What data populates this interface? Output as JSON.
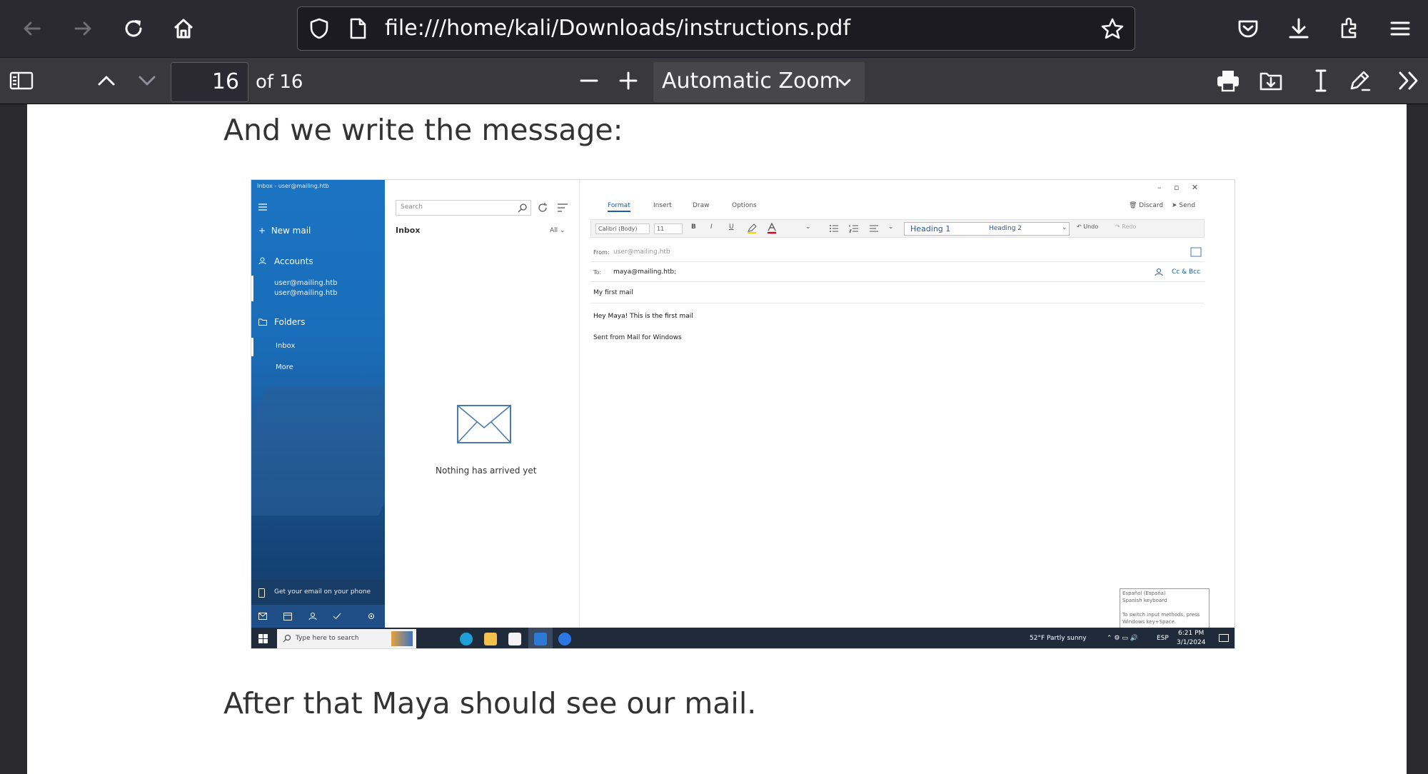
{
  "browser": {
    "url": "file:///home/kali/Downloads/instructions.pdf",
    "icons": [
      "back-arrow-icon",
      "forward-arrow-icon",
      "reload-icon",
      "home-icon",
      "shield-icon",
      "page-icon",
      "bookmark-star-icon",
      "pocket-icon",
      "download-icon",
      "extensions-icon",
      "hamburger-menu-icon"
    ]
  },
  "pdf_toolbar": {
    "page_number": "16",
    "page_count": "of 16",
    "zoom": "Automatic Zoom",
    "icons": [
      "sidebar-toggle-icon",
      "previous-page-icon",
      "next-page-icon",
      "zoom-out-icon",
      "zoom-in-icon",
      "print-icon",
      "save-icon",
      "text-select-icon",
      "draw-icon",
      "more-tools-icon"
    ]
  },
  "document": {
    "heading_text": "And we write the message:",
    "footer_text": "After that Maya should see our mail."
  },
  "screenshot": {
    "sidebar": {
      "window_title": "Inbox - user@mailing.htb",
      "new_mail": "New mail",
      "accounts": "Accounts",
      "account_1": "user@mailing.htb",
      "account_2": "user@mailing.htb",
      "folders": "Folders",
      "inbox": "Inbox",
      "more": "More",
      "phone_prompt": "Get your email on your phone"
    },
    "list": {
      "search_placeholder": "Search",
      "inbox_label": "Inbox",
      "filter": "All",
      "empty_message": "Nothing has arrived yet"
    },
    "compose": {
      "tabs": [
        "Format",
        "Insert",
        "Draw",
        "Options"
      ],
      "discard": "Discard",
      "send": "Send",
      "font": "Calibri (Body)",
      "font_size": "11",
      "style_1": "Heading 1",
      "style_2": "Heading 2",
      "undo": "Undo",
      "redo": "Redo",
      "from_label": "From:",
      "from_value": "user@mailing.htb",
      "to_label": "To:",
      "to_value": "maya@mailing.htb;",
      "cc_bcc": "Cc & Bcc",
      "subject": "My first mail",
      "body": "Hey Maya! This is the first mail",
      "signature": "Sent from Mail for Windows"
    },
    "taskbar": {
      "search_placeholder": "Type here to search",
      "weather": "52°F Partly sunny",
      "language": "ESP",
      "time": "6:21 PM",
      "date": "3/1/2024"
    },
    "ime_popup": {
      "line_1": "Español (España)",
      "line_2": "Spanish keyboard",
      "line_3": "To switch input methods, press",
      "line_4": "Windows key+Space."
    }
  }
}
